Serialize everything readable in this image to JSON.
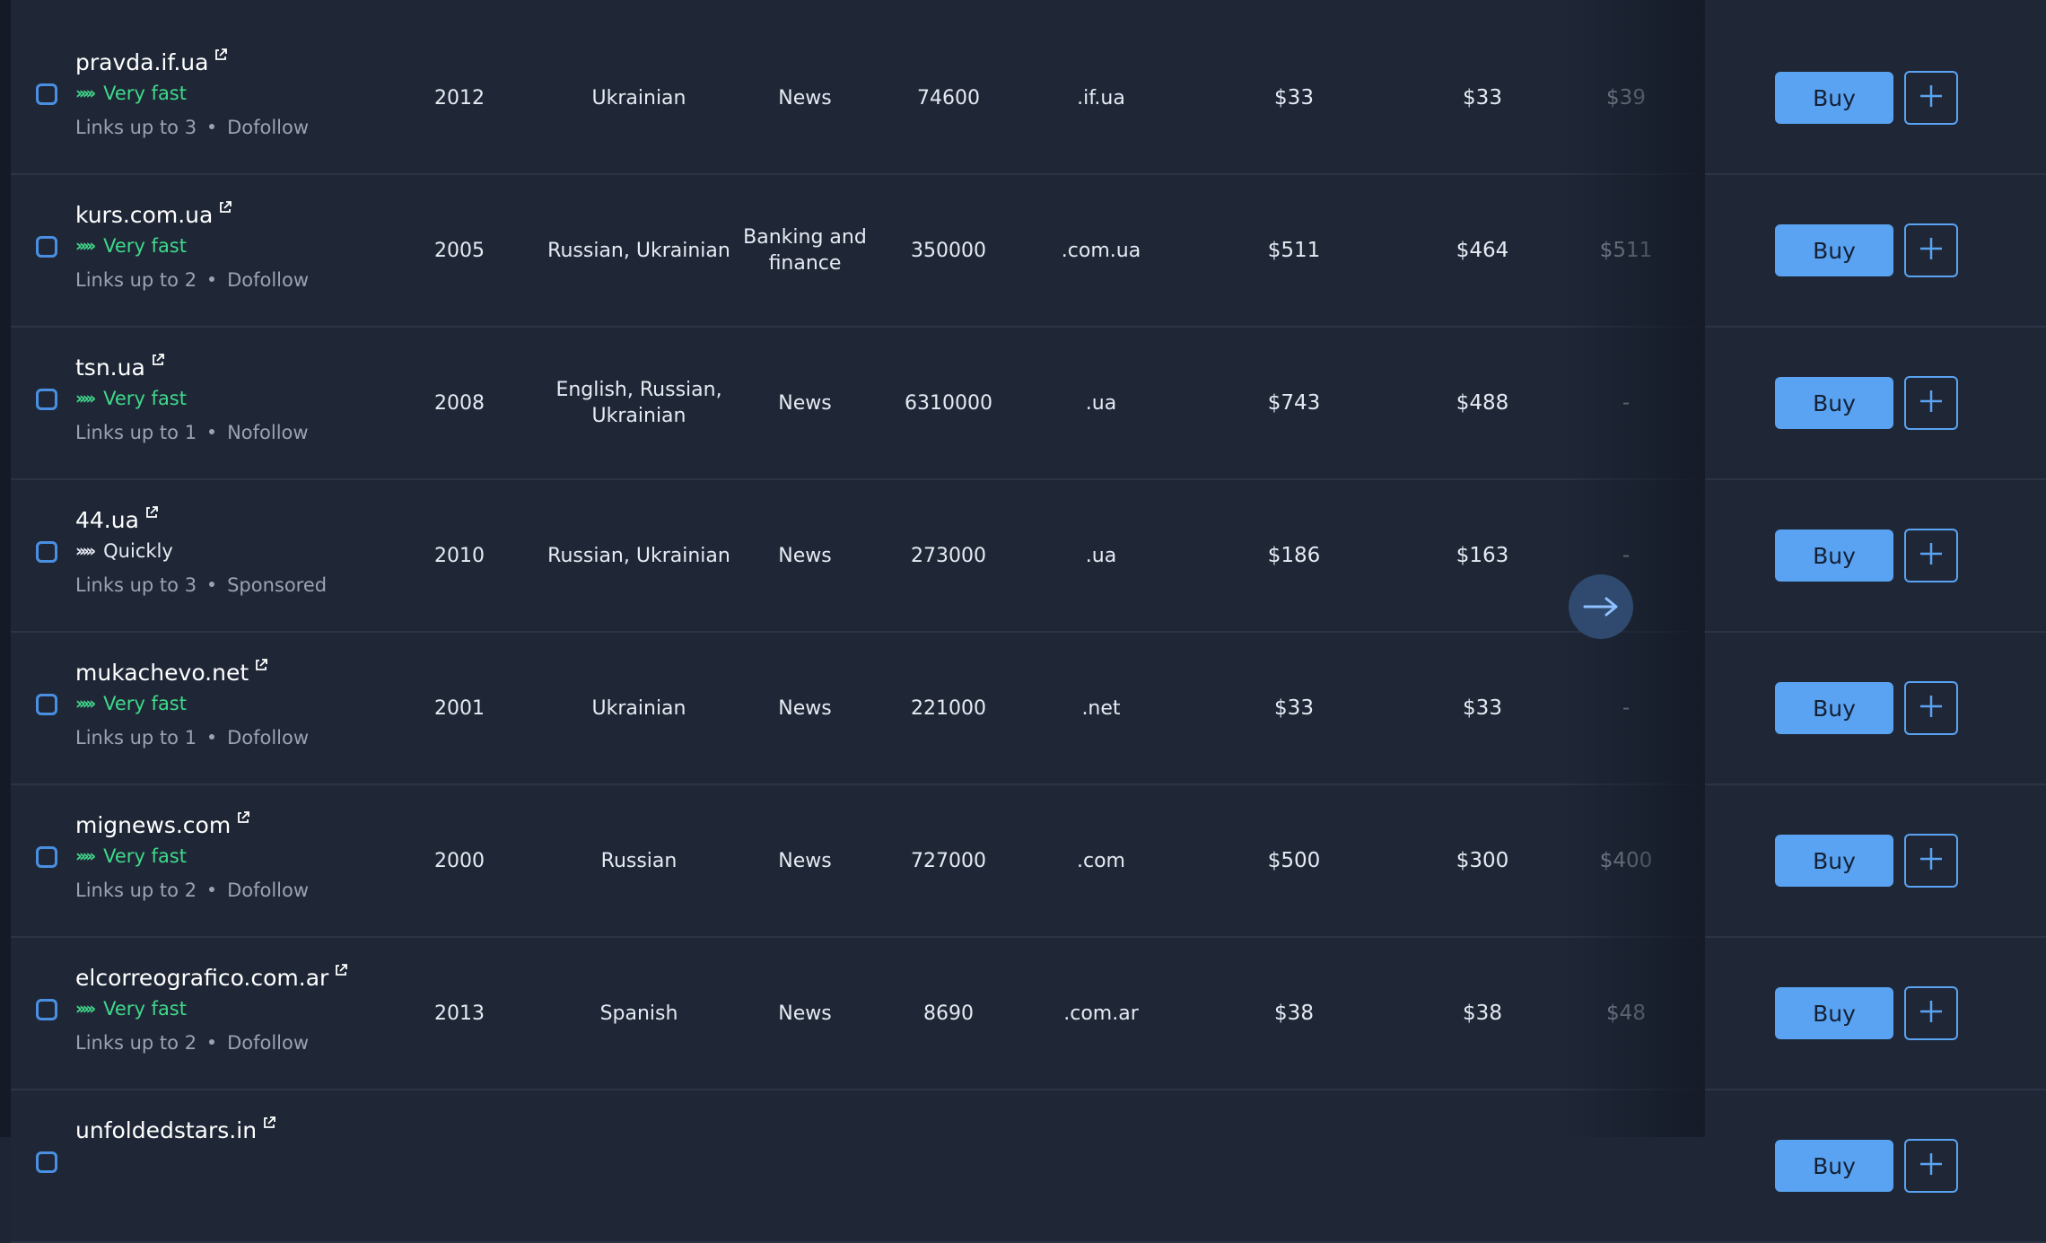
{
  "table": {
    "rows": [
      {
        "site": "pravda.if.ua",
        "speed": "Very fast",
        "speed_type": "fast",
        "links": "Links up to 3",
        "link_type": "Dofollow",
        "year": "2012",
        "language": "Ukrainian",
        "category": "News",
        "traffic": "74600",
        "domain": ".if.ua",
        "price1": "$33",
        "price2": "$33",
        "price3": "$39"
      },
      {
        "site": "kurs.com.ua",
        "speed": "Very fast",
        "speed_type": "fast",
        "links": "Links up to 2",
        "link_type": "Dofollow",
        "year": "2005",
        "language": "Russian, Ukrainian",
        "category": "Banking and finance",
        "traffic": "350000",
        "domain": ".com.ua",
        "price1": "$511",
        "price2": "$464",
        "price3": "$511"
      },
      {
        "site": "tsn.ua",
        "speed": "Very fast",
        "speed_type": "fast",
        "links": "Links up to 1",
        "link_type": "Nofollow",
        "year": "2008",
        "language": "English, Russian, Ukrainian",
        "category": "News",
        "traffic": "6310000",
        "domain": ".ua",
        "price1": "$743",
        "price2": "$488",
        "price3": "-"
      },
      {
        "site": "44.ua",
        "speed": "Quickly",
        "speed_type": "quick",
        "links": "Links up to 3",
        "link_type": "Sponsored",
        "year": "2010",
        "language": "Russian, Ukrainian",
        "category": "News",
        "traffic": "273000",
        "domain": ".ua",
        "price1": "$186",
        "price2": "$163",
        "price3": "-"
      },
      {
        "site": "mukachevo.net",
        "speed": "Very fast",
        "speed_type": "fast",
        "links": "Links up to 1",
        "link_type": "Dofollow",
        "year": "2001",
        "language": "Ukrainian",
        "category": "News",
        "traffic": "221000",
        "domain": ".net",
        "price1": "$33",
        "price2": "$33",
        "price3": "-"
      },
      {
        "site": "mignews.com",
        "speed": "Very fast",
        "speed_type": "fast",
        "links": "Links up to 2",
        "link_type": "Dofollow",
        "year": "2000",
        "language": "Russian",
        "category": "News",
        "traffic": "727000",
        "domain": ".com",
        "price1": "$500",
        "price2": "$300",
        "price3": "$400"
      },
      {
        "site": "elcorreografico.com.ar",
        "speed": "Very fast",
        "speed_type": "fast",
        "links": "Links up to 2",
        "link_type": "Dofollow",
        "year": "2013",
        "language": "Spanish",
        "category": "News",
        "traffic": "8690",
        "domain": ".com.ar",
        "price1": "$38",
        "price2": "$38",
        "price3": "$48"
      },
      {
        "site": "unfoldedstars.in",
        "speed": "",
        "speed_type": "fast",
        "links": "",
        "link_type": "",
        "year": "",
        "language": "",
        "category": "",
        "traffic": "",
        "domain": "",
        "price1": "",
        "price2": "",
        "price3": ""
      }
    ],
    "buy_label": "Buy"
  },
  "colors": {
    "accent": "#5aa3f2",
    "fast": "#3fd98a",
    "background": "#1e2636"
  },
  "icons": {
    "external": "external-link-icon",
    "add": "plus-icon",
    "scroll": "arrow-right-icon",
    "speed": "chevrons-right-icon"
  }
}
